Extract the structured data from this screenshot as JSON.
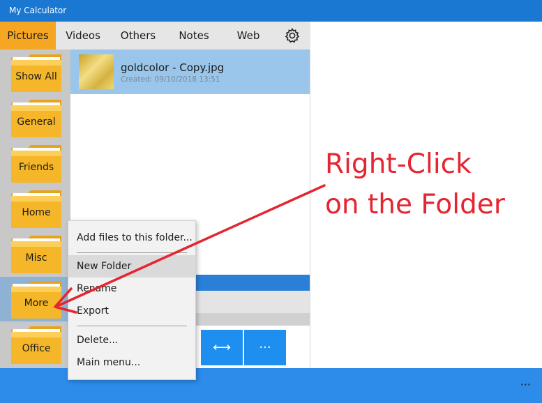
{
  "window": {
    "title": "My Calculator"
  },
  "tabs": [
    {
      "label": "Pictures",
      "active": true
    },
    {
      "label": "Videos"
    },
    {
      "label": "Others"
    },
    {
      "label": "Notes"
    },
    {
      "label": "Web"
    }
  ],
  "settings_icon": "gear-icon",
  "folders": [
    {
      "label": "Show All"
    },
    {
      "label": "General"
    },
    {
      "label": "Friends"
    },
    {
      "label": "Home"
    },
    {
      "label": "Misc"
    },
    {
      "label": "More",
      "selected": true
    },
    {
      "label": "Office"
    }
  ],
  "files": [
    {
      "name": "goldcolor - Copy.jpg",
      "created": "Created: 09/10/2018 13:51"
    }
  ],
  "toolbar": {
    "swap_icon": "⟷",
    "more_icon": "···"
  },
  "bottombar": {
    "more_icon": "···"
  },
  "context_menu": {
    "items": [
      {
        "label": "Add files to this folder..."
      },
      {
        "label": "New Folder",
        "highlighted": true
      },
      {
        "label": "Rename"
      },
      {
        "label": "Export"
      },
      {
        "label": "Delete..."
      },
      {
        "label": "Main menu..."
      }
    ]
  },
  "annotation": {
    "line1": "Right-Click",
    "line2": "on the Folder",
    "color": "#e52531"
  },
  "colors": {
    "accent": "#1a77d2",
    "tab_active": "#f5a623",
    "folder": "#f5b62a",
    "selection": "#99c6ea"
  }
}
